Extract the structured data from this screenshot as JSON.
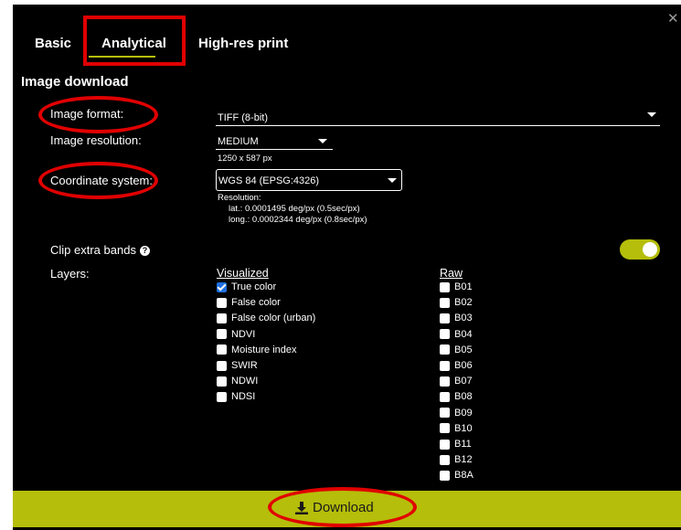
{
  "tabs": [
    {
      "label": "Basic"
    },
    {
      "label": "Analytical"
    },
    {
      "label": "High-res print"
    }
  ],
  "active_tab": "Analytical",
  "section_title": "Image download",
  "image_format": {
    "label": "Image format:",
    "value": "TIFF (8-bit)"
  },
  "image_resolution": {
    "label": "Image resolution:",
    "value": "MEDIUM",
    "size_text": "1250 x 587 px"
  },
  "coordinate_system": {
    "label": "Coordinate system:",
    "value": "WGS 84 (EPSG:4326)",
    "resolution_title": "Resolution:",
    "lat": "lat.: 0.0001495 deg/px (0.5sec/px)",
    "long": "long.: 0.0002344 deg/px (0.8sec/px)"
  },
  "clip_extra_bands": {
    "label": "Clip extra bands",
    "enabled": true
  },
  "layers": {
    "label": "Layers:",
    "visualized_header": "Visualized",
    "raw_header": "Raw",
    "visualized": [
      {
        "label": "True color",
        "checked": true
      },
      {
        "label": "False color",
        "checked": false
      },
      {
        "label": "False color (urban)",
        "checked": false
      },
      {
        "label": "NDVI",
        "checked": false
      },
      {
        "label": "Moisture index",
        "checked": false
      },
      {
        "label": "SWIR",
        "checked": false
      },
      {
        "label": "NDWI",
        "checked": false
      },
      {
        "label": "NDSI",
        "checked": false
      }
    ],
    "raw": [
      {
        "label": "B01",
        "checked": false
      },
      {
        "label": "B02",
        "checked": false
      },
      {
        "label": "B03",
        "checked": false
      },
      {
        "label": "B04",
        "checked": false
      },
      {
        "label": "B05",
        "checked": false
      },
      {
        "label": "B06",
        "checked": false
      },
      {
        "label": "B07",
        "checked": false
      },
      {
        "label": "B08",
        "checked": false
      },
      {
        "label": "B09",
        "checked": false
      },
      {
        "label": "B10",
        "checked": false
      },
      {
        "label": "B11",
        "checked": false
      },
      {
        "label": "B12",
        "checked": false
      },
      {
        "label": "B8A",
        "checked": false
      }
    ]
  },
  "download_label": "Download",
  "colors": {
    "accent": "#b5be0a",
    "highlight": "#e00000",
    "background": "#000000"
  }
}
